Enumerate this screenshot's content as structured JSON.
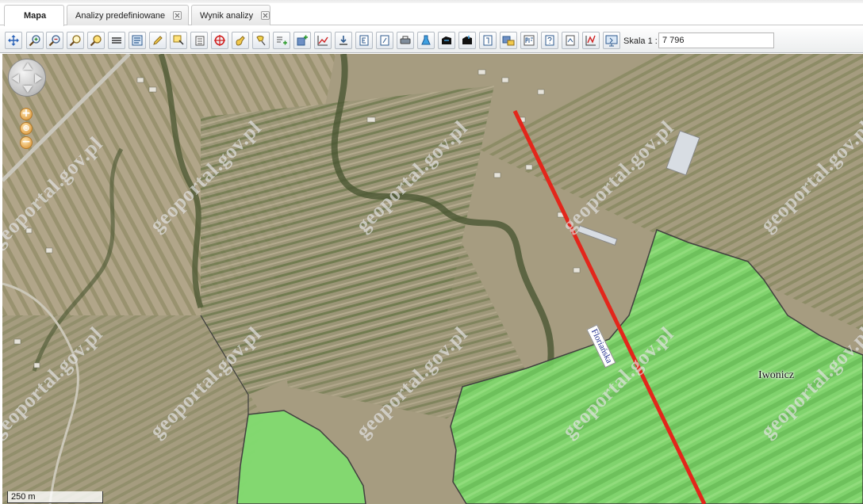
{
  "tabs": [
    {
      "label": "Mapa",
      "closable": false,
      "active": true
    },
    {
      "label": "Analizy predefiniowane",
      "closable": true,
      "active": false
    },
    {
      "label": "Wynik analizy",
      "closable": true,
      "active": false
    }
  ],
  "toolbar": {
    "tools": [
      {
        "name": "pan-tool"
      },
      {
        "name": "zoom-in-tool"
      },
      {
        "name": "zoom-out-tool"
      },
      {
        "name": "zoom-extent-tool"
      },
      {
        "name": "zoom-selection-tool"
      },
      {
        "name": "measure-tool"
      },
      {
        "name": "layers-tool"
      },
      {
        "name": "draw-tool"
      },
      {
        "name": "select-tool"
      },
      {
        "name": "list-tool"
      },
      {
        "name": "locate-tool"
      },
      {
        "name": "hand-tool"
      },
      {
        "name": "highlight-tool"
      },
      {
        "name": "add-object-tool"
      },
      {
        "name": "add-layer-tool"
      },
      {
        "name": "profile-tool"
      },
      {
        "name": "download-tool"
      },
      {
        "name": "export-e-tool"
      },
      {
        "name": "document-tool"
      },
      {
        "name": "print-tool"
      },
      {
        "name": "flask-tool"
      },
      {
        "name": "save-tool"
      },
      {
        "name": "save-as-tool"
      },
      {
        "name": "info-tool"
      },
      {
        "name": "compare-tool"
      },
      {
        "name": "pdf-tool"
      },
      {
        "name": "help-tool"
      },
      {
        "name": "chart-tool"
      },
      {
        "name": "window-tool"
      }
    ],
    "scale_label": "Skala 1 :",
    "scale_value": "7 796"
  },
  "map": {
    "street_label": "Floriańska",
    "town_label": "Iwonicz",
    "watermark_text": "geoportal.gov.pl",
    "scalebar_label": "250 m",
    "road_color": "#e3261b",
    "area_color": "#7fe070"
  }
}
